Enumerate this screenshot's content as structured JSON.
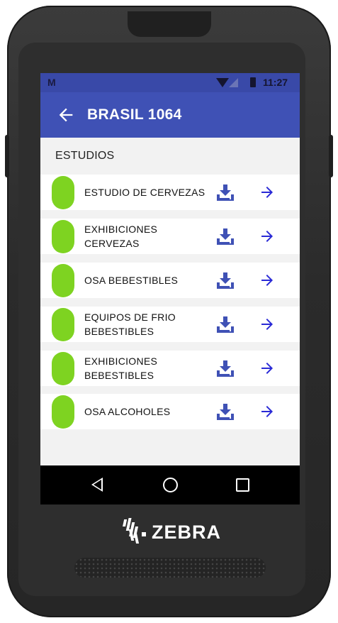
{
  "status_bar": {
    "notification_icon": "M",
    "time": "11:27",
    "icons": [
      "wifi-icon",
      "signal-icon",
      "battery-icon"
    ]
  },
  "app_bar": {
    "title": "BRASIL 1064",
    "back_icon": "arrow-left-icon"
  },
  "section": {
    "title": "ESTUDIOS"
  },
  "studies": [
    {
      "label": "ESTUDIO DE CERVEZAS",
      "status_color": "#7ed321"
    },
    {
      "label": "EXHIBICIONES CERVEZAS",
      "status_color": "#7ed321"
    },
    {
      "label": "OSA BEBESTIBLES",
      "status_color": "#7ed321"
    },
    {
      "label": "EQUIPOS DE FRIO BEBESTIBLES",
      "status_color": "#7ed321"
    },
    {
      "label": "EXHIBICIONES BEBESTIBLES",
      "status_color": "#7ed321"
    },
    {
      "label": "OSA ALCOHOLES",
      "status_color": "#7ed321"
    }
  ],
  "device": {
    "brand": "ZEBRA"
  },
  "colors": {
    "primary": "#3f51b5",
    "status_bar": "#3949a8",
    "accent_arrow": "#2a2ad6",
    "download_icon": "#3f51b5",
    "status_green": "#7ed321"
  }
}
